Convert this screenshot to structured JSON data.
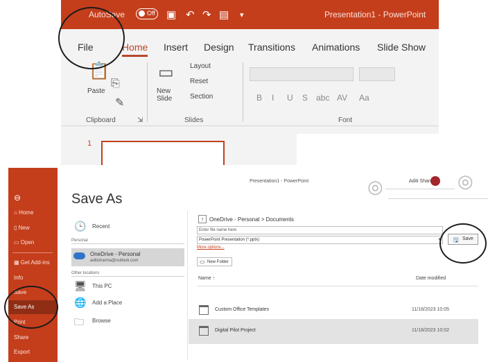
{
  "ribbon": {
    "autosave_label": "AutoSave",
    "autosave_state": "Off",
    "window_title": "Presentation1 - PowerPoint",
    "tabs": [
      "File",
      "Home",
      "Insert",
      "Design",
      "Transitions",
      "Animations",
      "Slide Show"
    ],
    "active_tab": "Home",
    "clipboard": {
      "paste_label": "Paste",
      "group_label": "Clipboard"
    },
    "slides": {
      "new_slide_label": "New\nSlide",
      "layout_label": "Layout",
      "reset_label": "Reset",
      "section_label": "Section",
      "group_label": "Slides"
    },
    "font": {
      "group_label": "Font",
      "format_buttons": [
        "B",
        "I",
        "U",
        "S",
        "abc",
        "AV",
        "Aa"
      ]
    },
    "slide_number": "1"
  },
  "backstage": {
    "doc_title": "Presentation1 - PowerPoint",
    "user_name": "Aditi Sharma",
    "nav": {
      "back_icon": "back-arrow-icon",
      "items": [
        {
          "label": "Home",
          "icon": "home-icon"
        },
        {
          "label": "New",
          "icon": "new-icon"
        },
        {
          "label": "Open",
          "icon": "folder-icon"
        },
        {
          "label": "Get Add-ins",
          "icon": "store-icon"
        },
        {
          "label": "Info"
        },
        {
          "label": "Save"
        },
        {
          "label": "Save As",
          "selected": true
        },
        {
          "label": "Print"
        },
        {
          "label": "Share"
        },
        {
          "label": "Export"
        }
      ]
    },
    "heading": "Save As",
    "locations": {
      "recent": "Recent",
      "section_personal": "Personal",
      "onedrive_title": "OneDrive - Personal",
      "onedrive_email": "aditisharma@outlook.com",
      "section_other": "Other locations",
      "this_pc": "This PC",
      "add_place": "Add a Place",
      "browse": "Browse"
    },
    "file_pane": {
      "path": "OneDrive - Personal > Documents",
      "name_placeholder": "Enter file name here",
      "file_type": "PowerPoint Presentation (*.pptx)",
      "more_options": "More options...",
      "save_button": "Save",
      "new_folder": "New Folder",
      "col_name": "Name",
      "col_date": "Date modified",
      "files": [
        {
          "name": "Custom Office Templates",
          "date": "11/18/2023 10:05"
        },
        {
          "name": "Digital Pilot Project",
          "date": "11/18/2023 10:02",
          "selected": true
        }
      ]
    }
  }
}
